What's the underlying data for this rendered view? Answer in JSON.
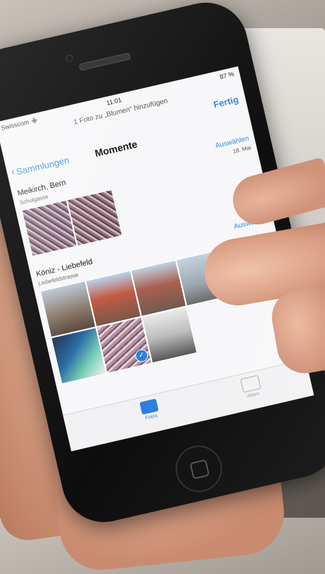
{
  "status_bar": {
    "carrier": "Swisscom",
    "time": "11:01",
    "battery": "87 %"
  },
  "prompt": "1 Foto zu „Blumen“ hinzufügen",
  "done_label": "Fertig",
  "nav": {
    "back_label": "Sammlungen",
    "title": "Momente"
  },
  "moments": [
    {
      "title": "Meikirch, Bern",
      "subtitle": "Schulgasse",
      "select_label": "Auswählen",
      "date": "18. Mai"
    },
    {
      "title": "Köniz - Liebefeld",
      "subtitle": "Liebefeldstrasse",
      "select_label": "Auswählen"
    }
  ],
  "tabs": [
    {
      "label": "Fotos",
      "active": true
    },
    {
      "label": "Alben",
      "active": false
    }
  ],
  "colors": {
    "accent": "#3a8de0",
    "phone_body": "#111111",
    "screen_bg": "#f7f7f9"
  },
  "icons": {
    "back": "chevron-left-icon",
    "selected": "checkmark-icon",
    "wifi": "wifi-icon"
  }
}
